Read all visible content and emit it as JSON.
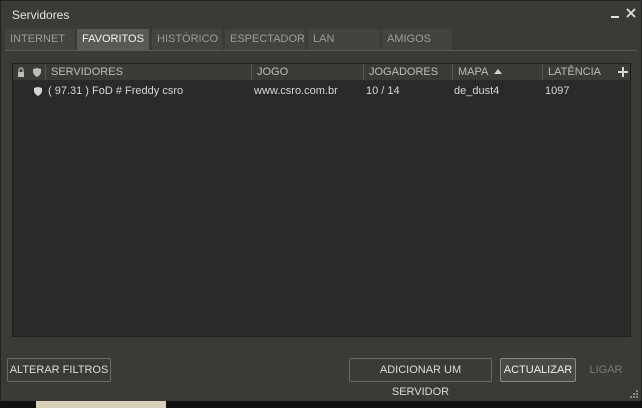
{
  "window": {
    "title": "Servidores"
  },
  "tabs": [
    {
      "label": "INTERNET",
      "active": false
    },
    {
      "label": "FAVORITOS",
      "active": true
    },
    {
      "label": "HISTÓRICO",
      "active": false
    },
    {
      "label": "ESPECTADOR",
      "active": false
    },
    {
      "label": "LAN",
      "active": false
    },
    {
      "label": "AMIGOS",
      "active": false
    }
  ],
  "columns": {
    "servers": "SERVIDORES",
    "game": "JOGO",
    "players": "JOGADORES",
    "map": "MAPA",
    "latency": "LATÊNCIA",
    "map_sort": "ascending"
  },
  "servers": [
    {
      "name": "( 97.31 )  FoD # Freddy  csro",
      "game": "www.csro.com.br",
      "players": "10 / 14",
      "map": "de_dust4",
      "latency": "1097",
      "secure": true
    }
  ],
  "buttons": {
    "change_filters": "ALTERAR FILTROS",
    "add_server": "ADICIONAR UM SERVIDOR",
    "refresh": "ACTUALIZAR",
    "connect": "LIGAR"
  },
  "icons": {
    "lock": "lock-icon",
    "shield": "shield-icon",
    "add": "plus-icon",
    "minimize": "minimize-icon",
    "close": "close-icon"
  }
}
